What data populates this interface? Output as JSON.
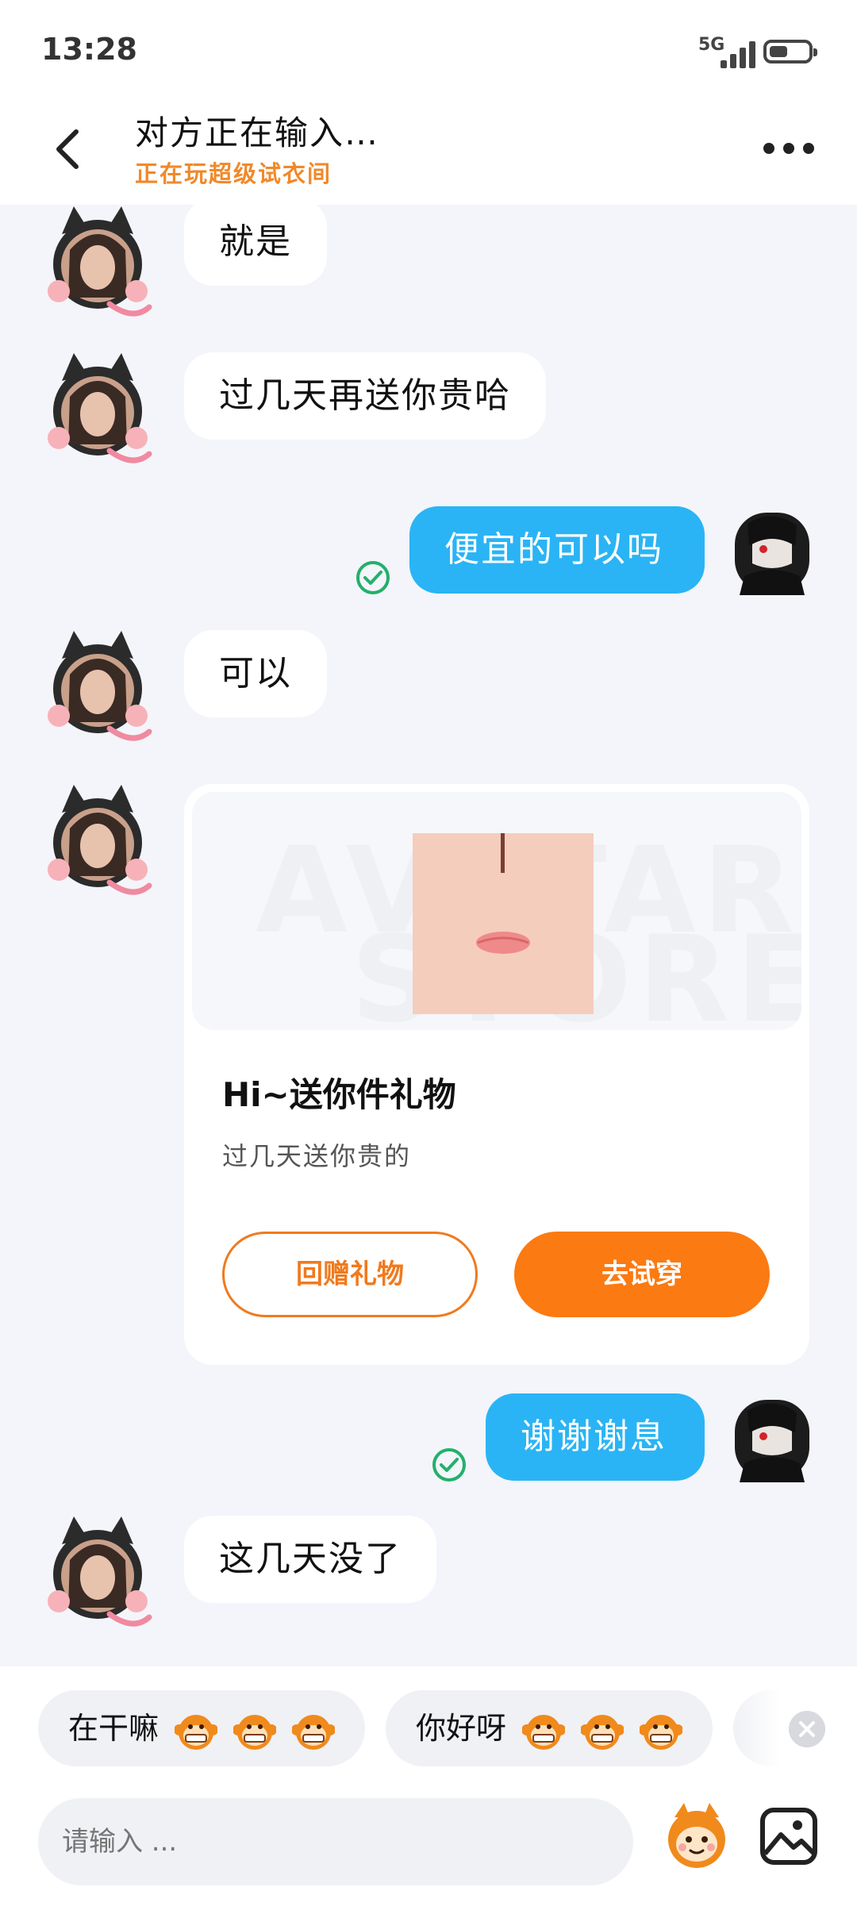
{
  "status_bar": {
    "time": "13:28",
    "network": "5G"
  },
  "header": {
    "title": "对方正在输入…",
    "subtitle": "正在玩超级试衣间"
  },
  "messages": [
    {
      "side": "in",
      "text": "就是"
    },
    {
      "side": "in",
      "text": "过几天再送你贵哈"
    },
    {
      "side": "out",
      "text": "便宜的可以吗"
    },
    {
      "side": "in",
      "text": "可以"
    },
    {
      "side": "out",
      "text": "谢谢谢息"
    },
    {
      "side": "in",
      "text": "这几天没了"
    }
  ],
  "gift_card": {
    "title": "Hi~送你件礼物",
    "description": "过几天送你贵的",
    "watermark_line1": "AVATAR",
    "watermark_line2": "STORE",
    "return_gift_label": "回赠礼物",
    "try_on_label": "去试穿"
  },
  "quick_replies": [
    {
      "text": "在干嘛",
      "emoji_icon": "grinning-monkey-icon"
    },
    {
      "text": "你好呀",
      "emoji_icon": "smiling-monkey-icon"
    }
  ],
  "composer": {
    "placeholder": "请输入 ..."
  },
  "colors": {
    "accent_orange": "#fb7a12",
    "outgoing_bubble": "#2ab4f5",
    "sent_check": "#23b06b",
    "subtitle_orange": "#f0892a"
  }
}
